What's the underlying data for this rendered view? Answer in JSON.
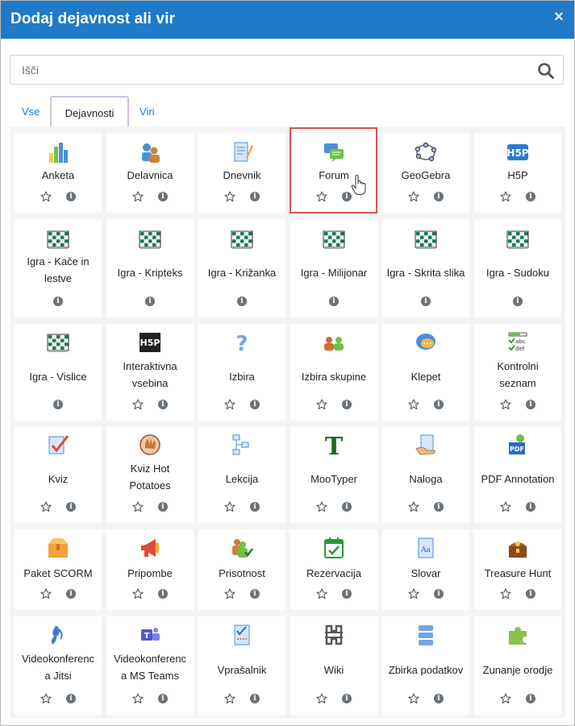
{
  "modal": {
    "title": "Dodaj dejavnost ali vir",
    "close_label": "×"
  },
  "search": {
    "placeholder": "Išči"
  },
  "tabs": [
    {
      "label": "Vse"
    },
    {
      "label": "Dejavnosti"
    },
    {
      "label": "Viri"
    }
  ],
  "activities": [
    {
      "name": "Anketa",
      "icon": "chart-bar-icon",
      "star": true
    },
    {
      "name": "Delavnica",
      "icon": "workshop-icon",
      "star": true
    },
    {
      "name": "Dnevnik",
      "icon": "journal-icon",
      "star": true
    },
    {
      "name": "Forum",
      "icon": "forum-icon",
      "star": true
    },
    {
      "name": "GeoGebra",
      "icon": "geogebra-icon",
      "star": true
    },
    {
      "name": "H5P",
      "icon": "h5p-icon",
      "star": true
    },
    {
      "name": "Igra - Kače in lestve",
      "icon": "game-icon",
      "star": false
    },
    {
      "name": "Igra - Kripteks",
      "icon": "game-icon",
      "star": false
    },
    {
      "name": "Igra - Križanka",
      "icon": "game-icon",
      "star": false
    },
    {
      "name": "Igra - Milijonar",
      "icon": "game-icon",
      "star": false
    },
    {
      "name": "Igra - Skrita slika",
      "icon": "game-icon",
      "star": false
    },
    {
      "name": "Igra - Sudoku",
      "icon": "game-icon",
      "star": false
    },
    {
      "name": "Igra - Vislice",
      "icon": "game-icon",
      "star": false
    },
    {
      "name": "Interaktivna vsebina",
      "icon": "h5p-dark-icon",
      "star": true
    },
    {
      "name": "Izbira",
      "icon": "question-icon",
      "star": true
    },
    {
      "name": "Izbira skupine",
      "icon": "group-choice-icon",
      "star": true
    },
    {
      "name": "Klepet",
      "icon": "chat-icon",
      "star": true
    },
    {
      "name": "Kontrolni seznam",
      "icon": "checklist-icon",
      "star": true
    },
    {
      "name": "Kviz",
      "icon": "quiz-icon",
      "star": true
    },
    {
      "name": "Kviz Hot Potatoes",
      "icon": "hotpot-icon",
      "star": true
    },
    {
      "name": "Lekcija",
      "icon": "lesson-icon",
      "star": true
    },
    {
      "name": "MooTyper",
      "icon": "mootyper-icon",
      "star": true
    },
    {
      "name": "Naloga",
      "icon": "assignment-icon",
      "star": true
    },
    {
      "name": "PDF Annotation",
      "icon": "pdf-icon",
      "star": true
    },
    {
      "name": "Paket SCORM",
      "icon": "scorm-icon",
      "star": true
    },
    {
      "name": "Pripombe",
      "icon": "feedback-icon",
      "star": true
    },
    {
      "name": "Prisotnost",
      "icon": "attendance-icon",
      "star": true
    },
    {
      "name": "Rezervacija",
      "icon": "calendar-check-icon",
      "star": true
    },
    {
      "name": "Slovar",
      "icon": "glossary-icon",
      "star": true
    },
    {
      "name": "Treasure Hunt",
      "icon": "treasure-icon",
      "star": true
    },
    {
      "name": "Videokonferenca Jitsi",
      "icon": "jitsi-icon",
      "star": true
    },
    {
      "name": "Videokonferenca MS Teams",
      "icon": "teams-icon",
      "star": true
    },
    {
      "name": "Vprašalnik",
      "icon": "questionnaire-icon",
      "star": true
    },
    {
      "name": "Wiki",
      "icon": "wiki-icon",
      "star": true
    },
    {
      "name": "Zbirka podatkov",
      "icon": "database-icon",
      "star": true
    },
    {
      "name": "Zunanje orodje",
      "icon": "puzzle-icon",
      "star": true
    }
  ],
  "colors": {
    "header": "#1f7ac9",
    "link": "#1f7ac9",
    "highlight": "#d9534f"
  }
}
